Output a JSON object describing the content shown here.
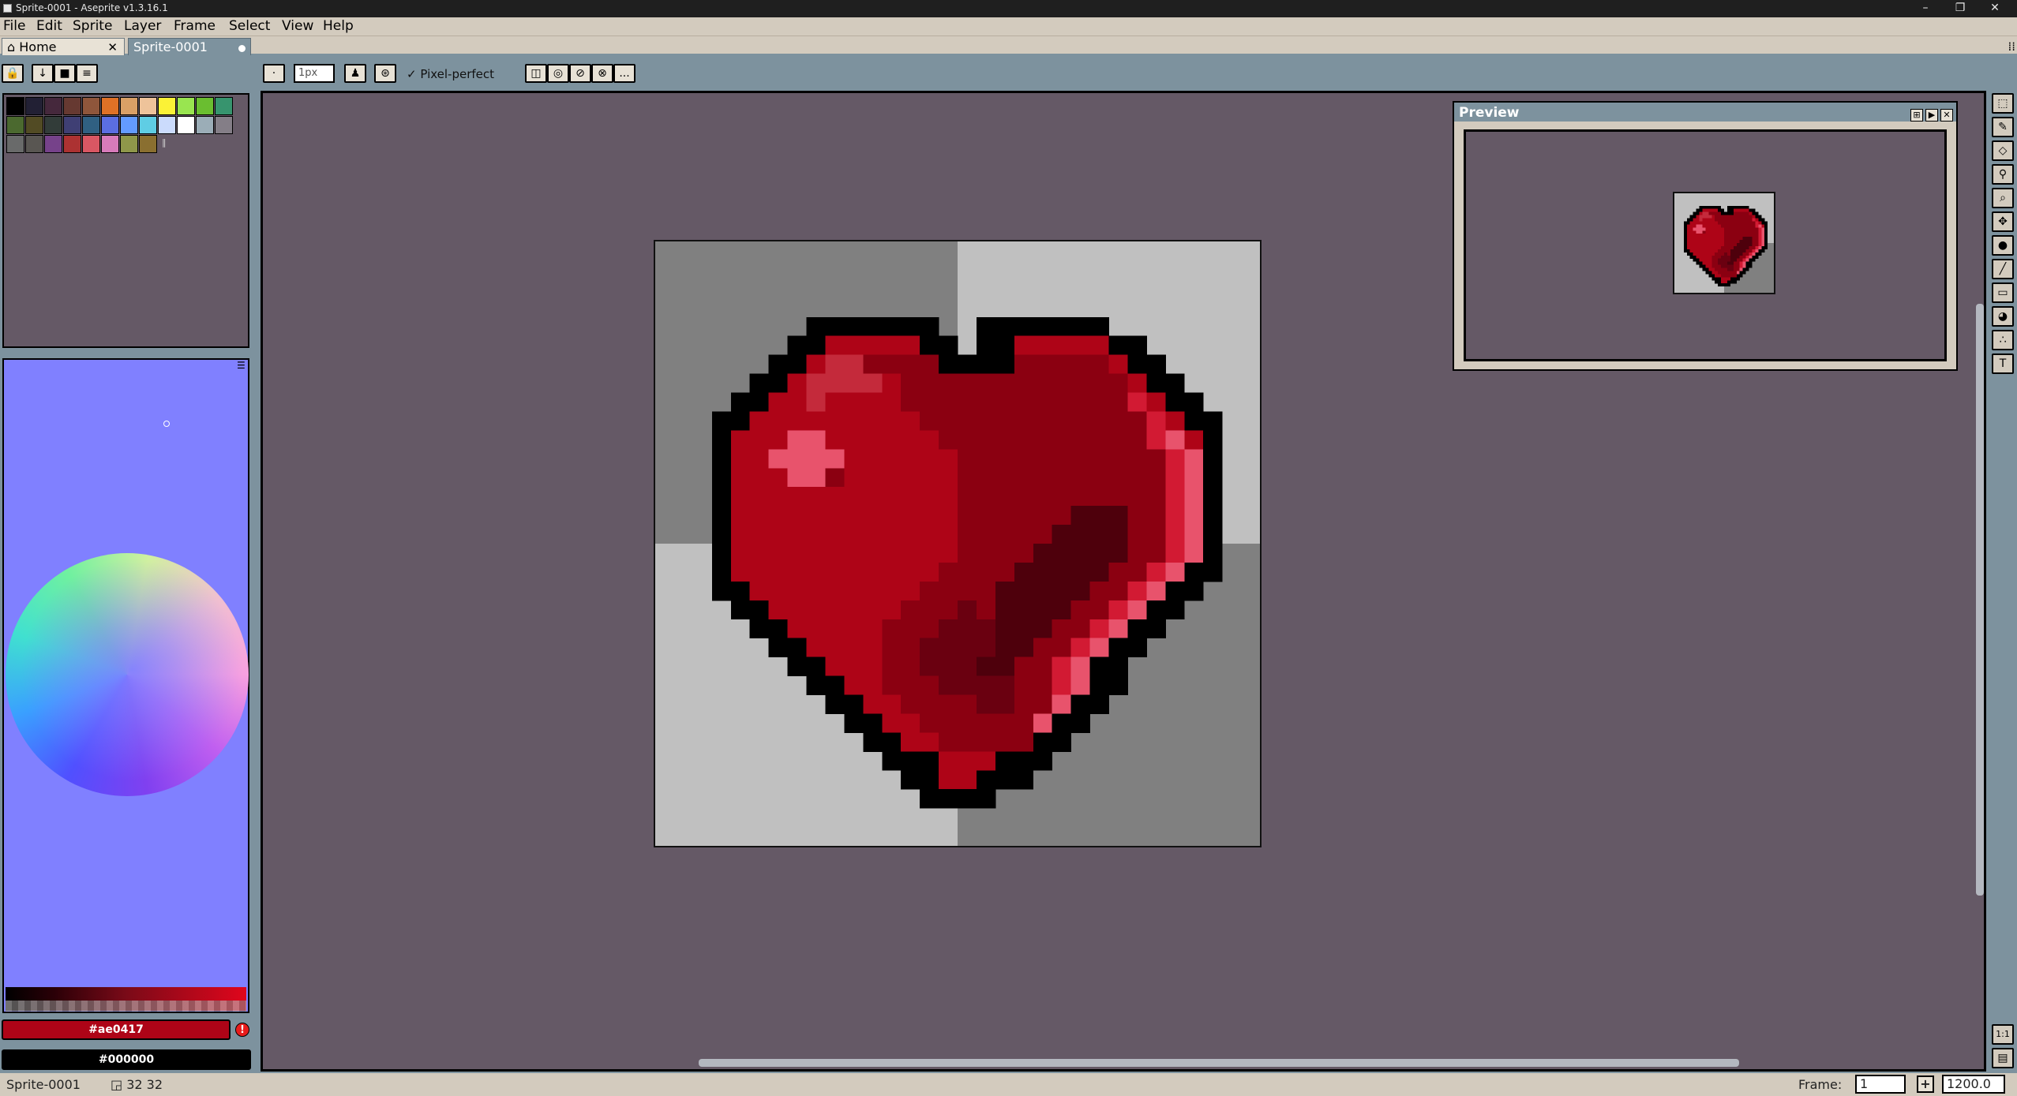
{
  "window": {
    "title": "Sprite-0001 - Aseprite v1.3.16.1",
    "minimize": "–",
    "restore": "❐",
    "close": "✕"
  },
  "menu": [
    "File",
    "Edit",
    "Sprite",
    "Layer",
    "Frame",
    "Select",
    "View",
    "Help"
  ],
  "tabs": {
    "home": "Home",
    "home_icon": "house-icon",
    "home_close": "✕",
    "sprite": "Sprite-0001"
  },
  "tabbar_end": "⁞⁞",
  "context": {
    "brush_size": "1px",
    "pixel_perfect_check": "✓",
    "pixel_perfect": "Pixel-perfect",
    "more": "..."
  },
  "palette": {
    "colors": [
      "#000000",
      "#222034",
      "#45283c",
      "#663931",
      "#8f563b",
      "#df7126",
      "#d9a066",
      "#eec39a",
      "#fbf236",
      "#99e550",
      "#6abe30",
      "#37946e",
      "#4b692f",
      "#524b24",
      "#323c39",
      "#3f3f74",
      "#306082",
      "#5b6ee1",
      "#639bff",
      "#5fcde4",
      "#cbdbfc",
      "#ffffff",
      "#9badb7",
      "#847e87",
      "#696a6a",
      "#595652",
      "#76428a",
      "#ac3232",
      "#d95763",
      "#d77bba",
      "#8f974a",
      "#8a6f30"
    ]
  },
  "color": {
    "foreground": "#ae0417",
    "background": "#000000",
    "warning": "!"
  },
  "preview": {
    "title": "Preview"
  },
  "tools": [
    "marquee-icon",
    "pencil-icon",
    "eraser-icon",
    "eyedropper-icon",
    "zoom-icon",
    "move-icon",
    "paint-bucket-icon",
    "line-icon",
    "rectangle-icon",
    "contour-icon",
    "blur-icon",
    "text-icon"
  ],
  "status": {
    "sprite_name": "Sprite-0001",
    "dims": "32 32",
    "frame_label": "Frame:",
    "frame_value": "1",
    "zoom": "1200.0"
  },
  "colors": {
    "canvas_bg": "#655966",
    "ui_bg": "#7d929e",
    "panel_light": "#d3cbbe"
  }
}
